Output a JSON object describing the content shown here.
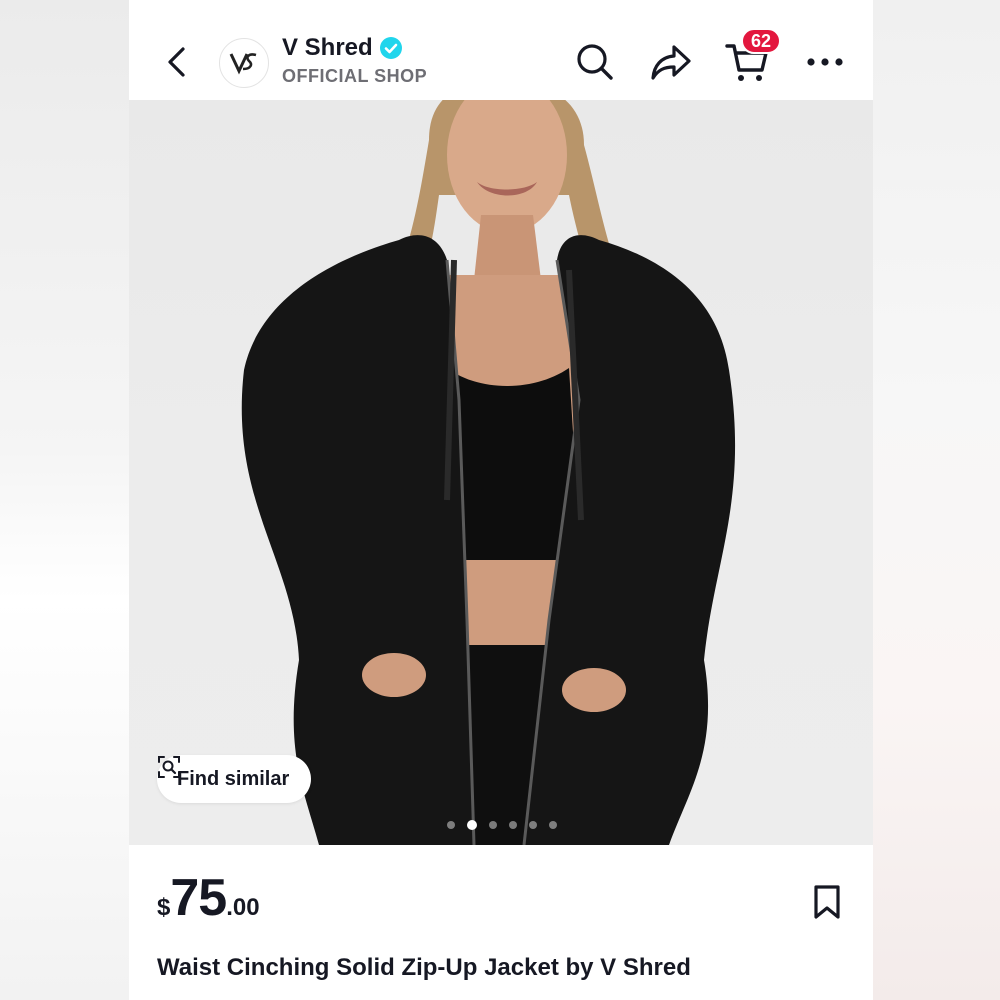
{
  "header": {
    "shop_name": "V Shred",
    "shop_subtitle": "OFFICIAL SHOP",
    "avatar_logo": "VS",
    "cart_count": "62",
    "icons": [
      "back-icon",
      "verified-icon",
      "search-icon",
      "share-icon",
      "cart-icon",
      "more-icon"
    ]
  },
  "product": {
    "find_similar_label": "Find similar",
    "carousel_total": 6,
    "carousel_active": 1,
    "price": {
      "currency": "$",
      "integer": "75",
      "decimal": ".00"
    },
    "title": "Waist Cinching Solid Zip-Up Jacket by V Shred",
    "save_icon": "bookmark-icon"
  },
  "colors": {
    "text": "#161823",
    "badge": "#e3173e",
    "verified": "#20d5ec",
    "subtitle": "#6e6e74"
  }
}
